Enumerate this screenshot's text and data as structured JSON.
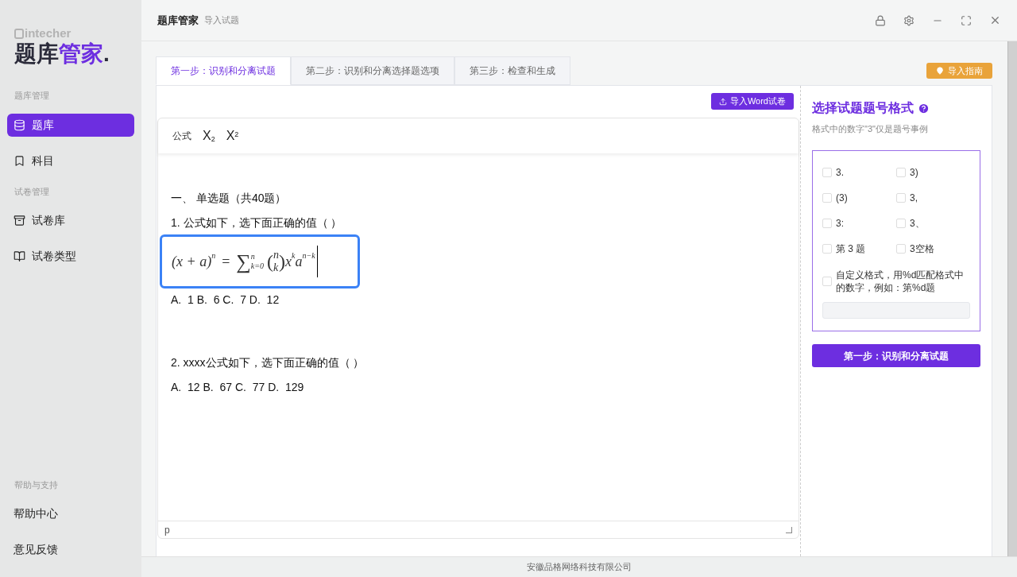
{
  "sidebar": {
    "brand": "intecher",
    "title_dark": "题库",
    "title_accent": "管家",
    "title_dot": ".",
    "sections": [
      {
        "heading": "题库管理",
        "items": [
          {
            "label": "题库",
            "selected": true
          },
          {
            "label": "科目",
            "selected": false
          }
        ]
      },
      {
        "heading": "试卷管理",
        "items": [
          {
            "label": "试卷库",
            "selected": false
          },
          {
            "label": "试卷类型",
            "selected": false
          }
        ]
      },
      {
        "heading": "帮助与支持",
        "items": [
          {
            "label": "帮助中心",
            "selected": false
          },
          {
            "label": "意见反馈",
            "selected": false
          }
        ]
      }
    ]
  },
  "header": {
    "title": "题库管家",
    "subtitle": "导入试题"
  },
  "tabs": [
    {
      "label": "第一步：识别和分离试题",
      "selected": true
    },
    {
      "label": "第二步：识别和分离选择题选项",
      "selected": false
    },
    {
      "label": "第三步：检查和生成",
      "selected": false
    }
  ],
  "guide_button": "导入指南",
  "import_button": "导入Word试卷",
  "toolbar": {
    "formula": "公式",
    "sub_base": "X",
    "sub": "2",
    "sup_base": "X",
    "sup": "2"
  },
  "content": [
    {
      "kind": "text",
      "text": "一、 单选题（共40题）"
    },
    {
      "kind": "text",
      "text": "1. 公式如下，选下面正确的值（ ）"
    },
    {
      "kind": "formula",
      "lhs": "(x + a)",
      "lhs_exp": "n",
      "eq": "=",
      "sum": "∑",
      "sum_upper": "n",
      "sum_lower": "k=0",
      "binom_open": "(",
      "binom_close": ")",
      "binom_top": "n",
      "binom_bottom": "k",
      "x": "x",
      "x_exp": "k",
      "a": "a",
      "a_exp": "n−k",
      "focused": true
    },
    {
      "kind": "text",
      "text": "A.  1 B.  6 C.  7 D.  12"
    },
    {
      "kind": "gap"
    },
    {
      "kind": "text",
      "text": "2. xxxx公式如下，选下面正确的值（ ）"
    },
    {
      "kind": "text",
      "text": "A.  12 B.  67 C.  77 D.  129"
    }
  ],
  "status_path": "p",
  "format_panel": {
    "title": "选择试题题号格式",
    "hint": "格式中的数字\"3\"仅是题号事例",
    "options": [
      {
        "label": "3.",
        "checked": false
      },
      {
        "label": "3)",
        "checked": false
      },
      {
        "label": "(3)",
        "checked": false
      },
      {
        "label": "3,",
        "checked": false
      },
      {
        "label": "3:",
        "checked": false
      },
      {
        "label": "3、",
        "checked": false
      },
      {
        "label": "第 3 题",
        "checked": false
      },
      {
        "label": "3空格",
        "checked": false
      }
    ],
    "custom": {
      "label": "自定义格式，用%d匹配格式中的数字，例如：第%d题",
      "checked": false
    },
    "submit": "第一步：识别和分离试题"
  },
  "footer": "安徽品格网络科技有限公司"
}
